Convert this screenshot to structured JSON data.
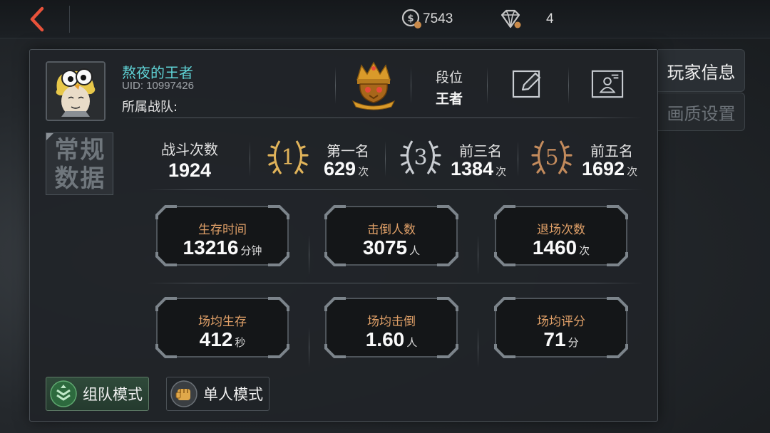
{
  "topbar": {
    "coins": "7543",
    "gems": "4",
    "icons": {
      "back": "chevron-left-icon",
      "coin": "coin-icon",
      "gem": "gem-icon"
    }
  },
  "side_tabs": {
    "player_info": "玩家信息",
    "graphics": "画质设置"
  },
  "player": {
    "name": "熬夜的王者",
    "uid": "UID: 10997426",
    "team": "所属战队:",
    "rank_label": "段位",
    "rank_value": "王者"
  },
  "category": {
    "label": "常规\n数据"
  },
  "summary": {
    "battles_label": "战斗次数",
    "battles_value": "1924",
    "placements": [
      {
        "badge": "1",
        "label": "第一名",
        "value": "629",
        "unit": "次",
        "color": "#e0b35a"
      },
      {
        "badge": "3",
        "label": "前三名",
        "value": "1384",
        "unit": "次",
        "color": "#c9cdd2"
      },
      {
        "badge": "5",
        "label": "前五名",
        "value": "1692",
        "unit": "次",
        "color": "#c28a5c"
      }
    ]
  },
  "stats": [
    {
      "label": "生存时间",
      "value": "13216",
      "unit": "分钟"
    },
    {
      "label": "击倒人数",
      "value": "3075",
      "unit": "人"
    },
    {
      "label": "退场次数",
      "value": "1460",
      "unit": "次"
    },
    {
      "label": "场均生存",
      "value": "412",
      "unit": "秒"
    },
    {
      "label": "场均击倒",
      "value": "1.60",
      "unit": "人"
    },
    {
      "label": "场均评分",
      "value": "71",
      "unit": "分"
    }
  ],
  "modes": {
    "team": "组队模式",
    "solo": "单人模式"
  },
  "colors": {
    "accent_cyan": "#5fd3d6",
    "stat_label": "#e0a068",
    "team_green": "#3f8f55"
  }
}
